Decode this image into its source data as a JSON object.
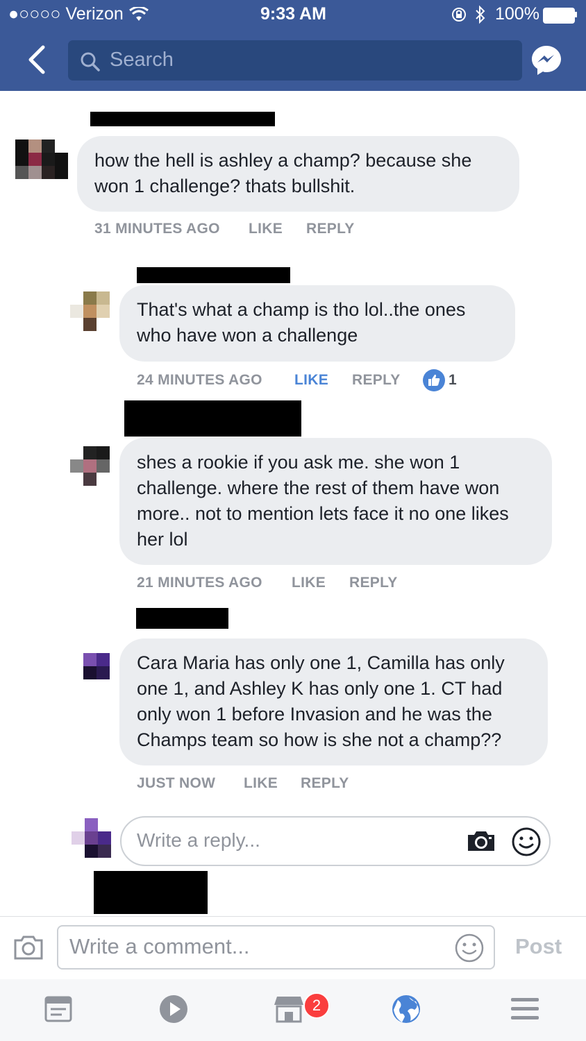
{
  "status_bar": {
    "carrier": "●○○○○ Verizon",
    "time": "9:33 AM",
    "battery": "100%"
  },
  "header": {
    "search_placeholder": "Search"
  },
  "comments": [
    {
      "text": "how the hell is ashley a champ? because she won 1 challenge? thats bullshit.",
      "time": "31 MINUTES AGO",
      "like": "LIKE",
      "reply": "REPLY"
    },
    {
      "text": "That's what a champ is tho lol..the ones who have won a challenge",
      "time": "24 MINUTES AGO",
      "like": "LIKE",
      "reply": "REPLY",
      "likes": "1"
    },
    {
      "text": "shes a rookie if you ask me. she won 1 challenge. where the rest of them have won more.. not to mention lets face it no one likes her lol",
      "time": "21 MINUTES AGO",
      "like": "LIKE",
      "reply": "REPLY"
    },
    {
      "text": "Cara Maria has only one 1, Camilla has only one 1, and Ashley K has only one 1. CT had only won 1 before Invasion and he was the Champs team so how is she not a champ??",
      "time": "JUST NOW",
      "like": "LIKE",
      "reply": "REPLY"
    }
  ],
  "reply_box": {
    "placeholder": "Write a reply..."
  },
  "comment_bar": {
    "placeholder": "Write a comment...",
    "post": "Post"
  },
  "tab_bar": {
    "badge": "2"
  },
  "colors": {
    "header": "#3b5998",
    "bubble": "#ebedf0",
    "meta": "#90949c",
    "like_active": "#4a84d6"
  }
}
